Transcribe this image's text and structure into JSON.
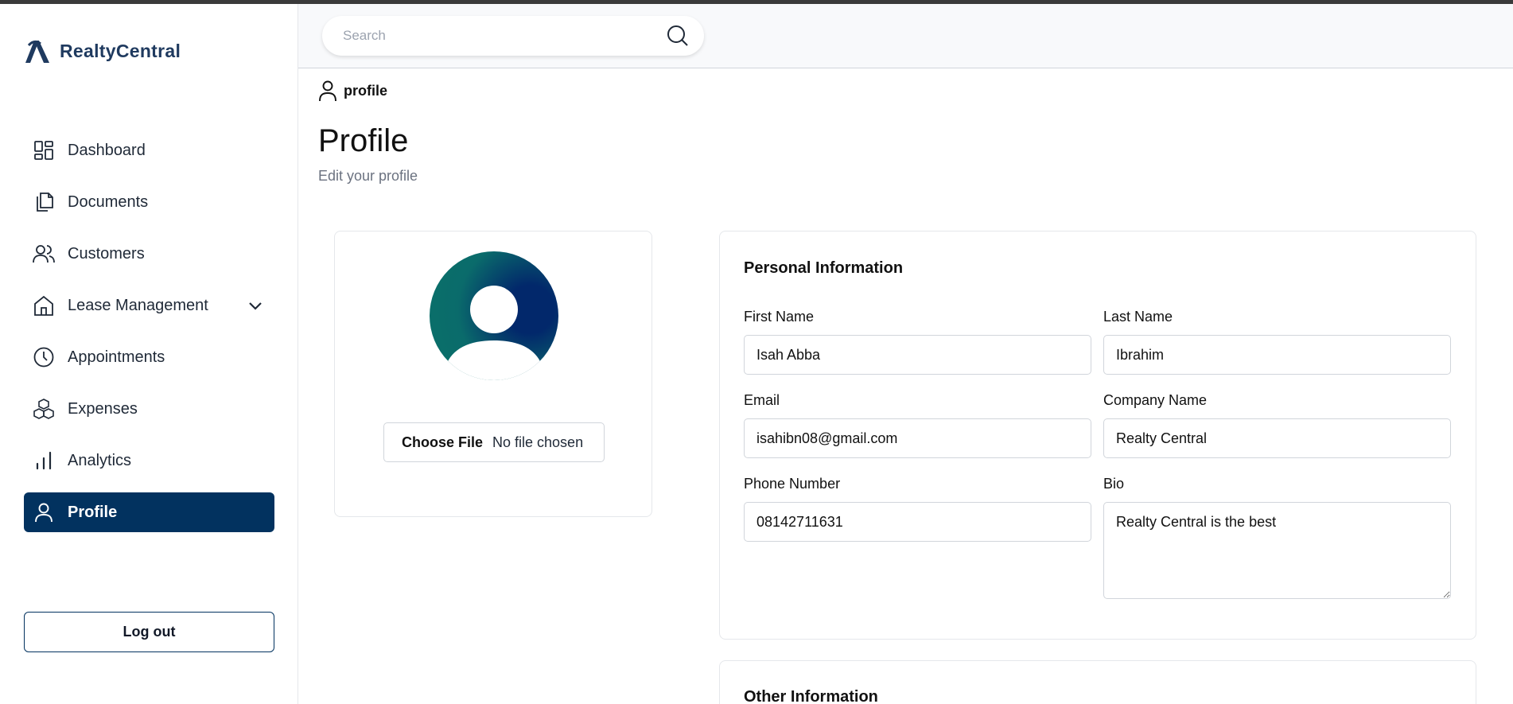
{
  "app": {
    "name": "RealtyCentral"
  },
  "search": {
    "placeholder": "Search"
  },
  "sidebar": {
    "items": [
      {
        "label": "Dashboard",
        "icon": "grid-icon"
      },
      {
        "label": "Documents",
        "icon": "documents-icon"
      },
      {
        "label": "Customers",
        "icon": "users-icon"
      },
      {
        "label": "Lease Management",
        "icon": "home-icon",
        "expandable": true
      },
      {
        "label": "Appointments",
        "icon": "clock-icon"
      },
      {
        "label": "Expenses",
        "icon": "cubes-icon"
      },
      {
        "label": "Analytics",
        "icon": "bar-chart-icon"
      },
      {
        "label": "Profile",
        "icon": "user-icon",
        "active": true
      }
    ],
    "logout_label": "Log out"
  },
  "breadcrumb": {
    "label": "profile",
    "icon": "user-icon"
  },
  "page": {
    "title": "Profile",
    "subtitle": "Edit your profile"
  },
  "avatar_card": {
    "choose_file_label": "Choose File",
    "no_file_label": "No file chosen"
  },
  "personal_info": {
    "title": "Personal Information",
    "first_name": {
      "label": "First Name",
      "value": "Isah Abba"
    },
    "last_name": {
      "label": "Last Name",
      "value": "Ibrahim"
    },
    "email": {
      "label": "Email",
      "value": "isahibn08@gmail.com"
    },
    "company_name": {
      "label": "Company Name",
      "value": "Realty Central"
    },
    "phone": {
      "label": "Phone Number",
      "value": "08142711631"
    },
    "bio": {
      "label": "Bio",
      "value": "Realty Central is the best"
    }
  },
  "other_info": {
    "title": "Other Information"
  },
  "colors": {
    "primary": "#02325f",
    "logo_text": "#1f3a5f",
    "avatar_gradient_start": "#0a6b6b",
    "avatar_gradient_end": "#02286b"
  }
}
